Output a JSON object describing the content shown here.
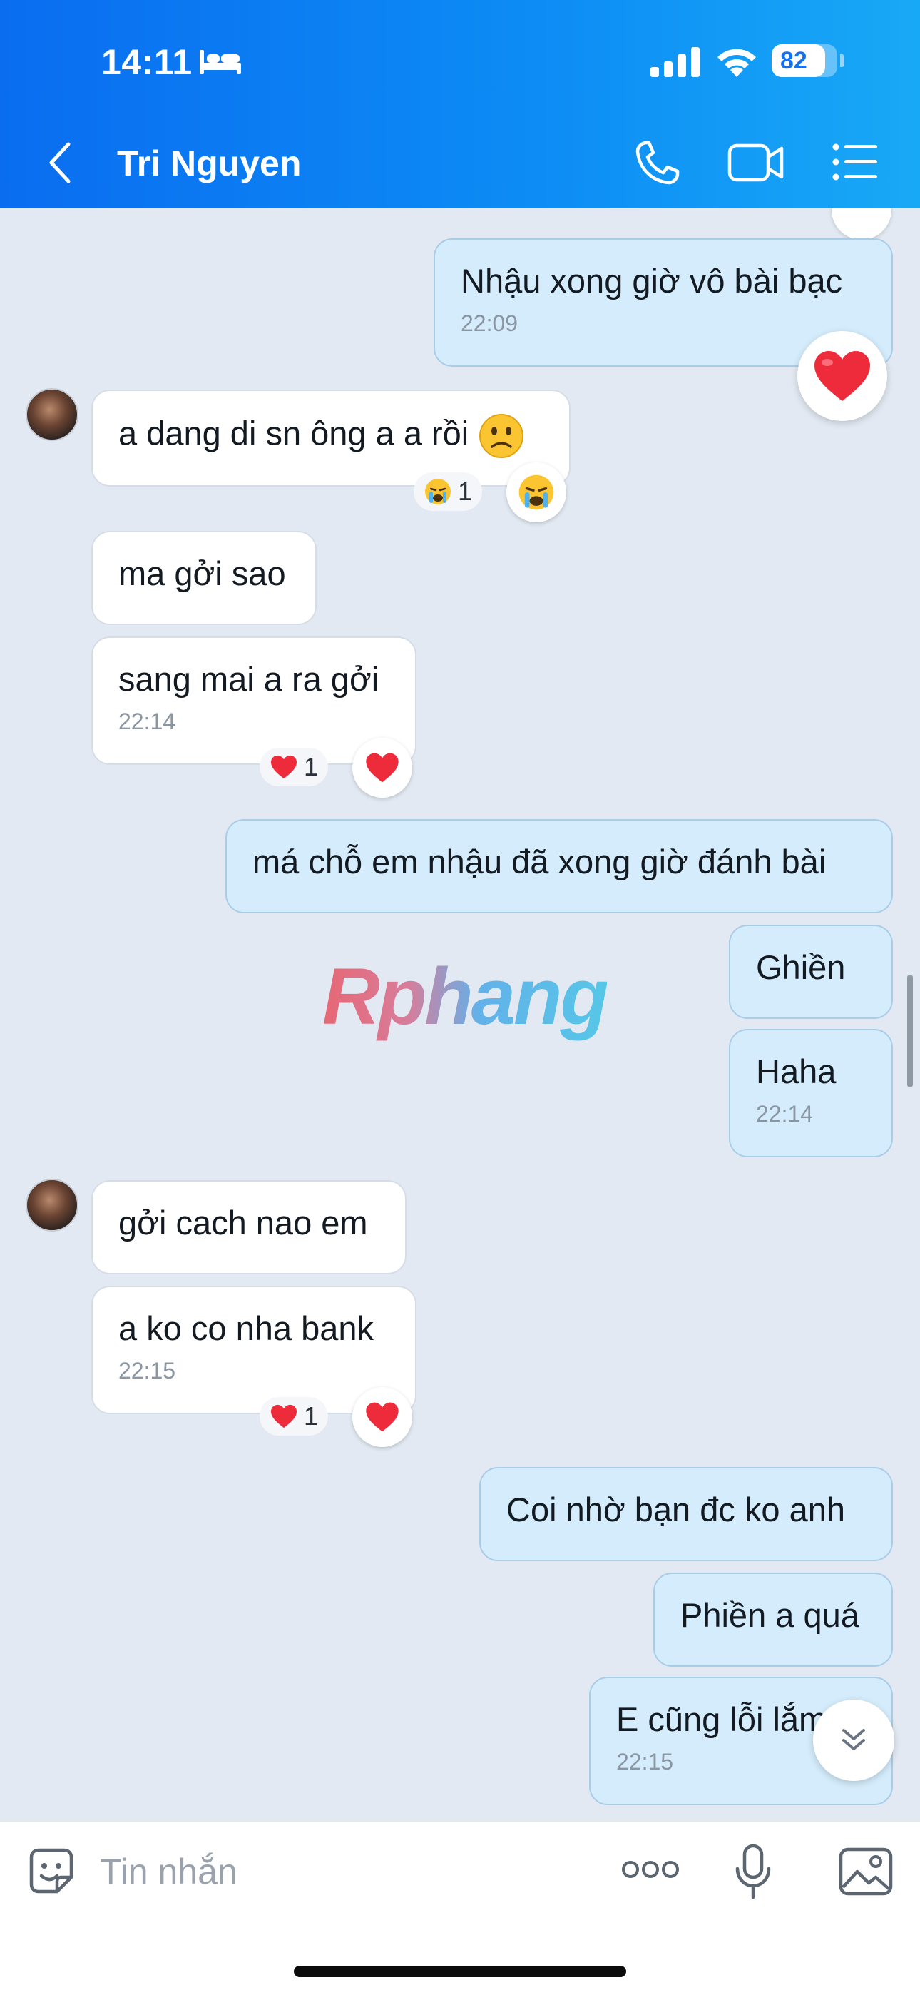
{
  "status_bar": {
    "time": "14:11",
    "battery": "82"
  },
  "header": {
    "contact_name": "Tri Nguyen"
  },
  "messages": [
    {
      "text": "Nhậu xong giờ vô bài bạc",
      "time": "22:09"
    },
    {
      "text": "a dang di sn ông a a rồi",
      "reaction_count": "1"
    },
    {
      "text": "ma gởi sao"
    },
    {
      "text": "sang mai a ra gởi",
      "time": "22:14",
      "reaction_count": "1"
    },
    {
      "text": "má chỗ em nhậu đã xong giờ đánh bài"
    },
    {
      "text": "Ghiền"
    },
    {
      "text": "Haha",
      "time": "22:14"
    },
    {
      "text": "gởi cach nao em"
    },
    {
      "text": "a ko co nha bank",
      "time": "22:15",
      "reaction_count": "1"
    },
    {
      "text": "Coi nhờ bạn đc ko anh"
    },
    {
      "text": "Phiền a quá"
    },
    {
      "text": "E cũng lỗi lắm",
      "time": "22:15"
    }
  ],
  "watermark": "Rphang",
  "composer": {
    "placeholder": "Tin nhắn"
  },
  "colors": {
    "header": "#0d8df5",
    "sent_bubble": "#d4ecfb",
    "received_bubble": "#ffffff",
    "background": "#e2e9f2"
  }
}
